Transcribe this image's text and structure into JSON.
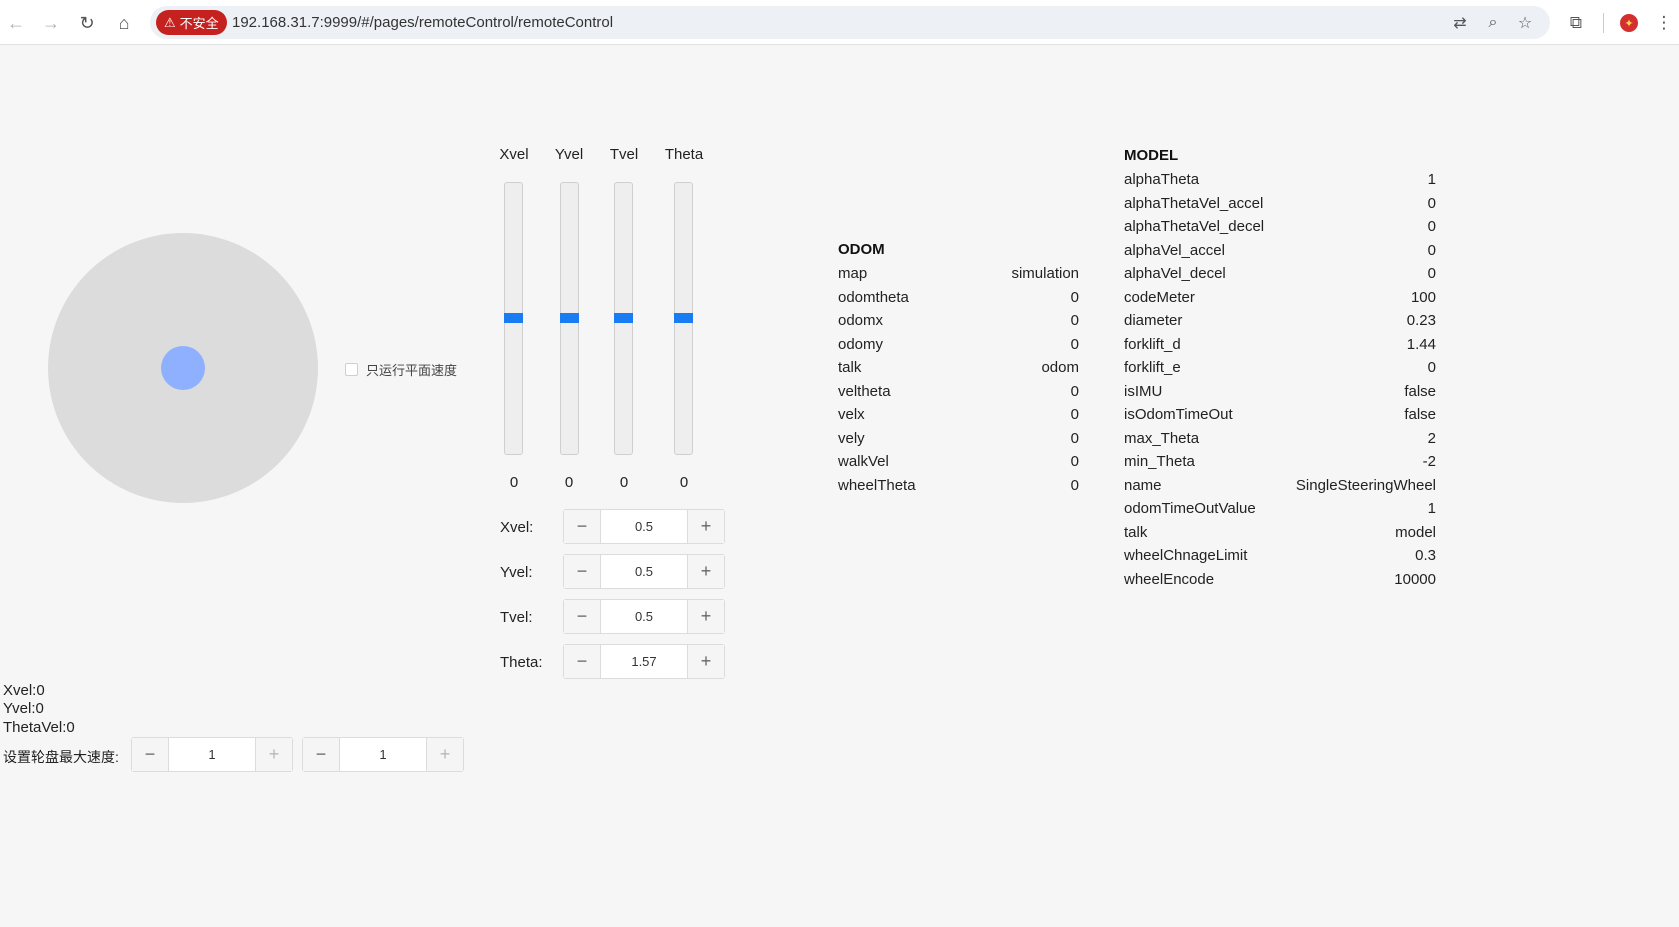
{
  "browser": {
    "url": "192.168.31.7:9999/#/pages/remoteControl/remoteControl",
    "insecure_label": "不安全"
  },
  "joystick": {
    "checkbox_label": "只运行平面速度",
    "checked": false
  },
  "sliders": [
    {
      "label": "Xvel",
      "value": "0"
    },
    {
      "label": "Yvel",
      "value": "0"
    },
    {
      "label": "Tvel",
      "value": "0"
    },
    {
      "label": "Theta",
      "value": "0"
    }
  ],
  "steppers": [
    {
      "label": "Xvel:",
      "value": "0.5"
    },
    {
      "label": "Yvel:",
      "value": "0.5"
    },
    {
      "label": "Tvel:",
      "value": "0.5"
    },
    {
      "label": "Theta:",
      "value": "1.57"
    }
  ],
  "readouts": {
    "xvel": "Xvel:0",
    "yvel": "Yvel:0",
    "thetavel": "ThetaVel:0"
  },
  "max_speed": {
    "label": "设置轮盘最大速度:",
    "value1": "1",
    "value2": "1"
  },
  "odom": {
    "title": "ODOM",
    "rows": [
      {
        "key": "map",
        "value": "simulation"
      },
      {
        "key": "odomtheta",
        "value": "0"
      },
      {
        "key": "odomx",
        "value": "0"
      },
      {
        "key": "odomy",
        "value": "0"
      },
      {
        "key": "talk",
        "value": "odom"
      },
      {
        "key": "veltheta",
        "value": "0"
      },
      {
        "key": "velx",
        "value": "0"
      },
      {
        "key": "vely",
        "value": "0"
      },
      {
        "key": "walkVel",
        "value": "0"
      },
      {
        "key": "wheelTheta",
        "value": "0"
      }
    ]
  },
  "model": {
    "title": "MODEL",
    "rows": [
      {
        "key": "alphaTheta",
        "value": "1"
      },
      {
        "key": "alphaThetaVel_accel",
        "value": "0"
      },
      {
        "key": "alphaThetaVel_decel",
        "value": "0"
      },
      {
        "key": "alphaVel_accel",
        "value": "0"
      },
      {
        "key": "alphaVel_decel",
        "value": "0"
      },
      {
        "key": "codeMeter",
        "value": "100"
      },
      {
        "key": "diameter",
        "value": "0.23"
      },
      {
        "key": "forklift_d",
        "value": "1.44"
      },
      {
        "key": "forklift_e",
        "value": "0"
      },
      {
        "key": "isIMU",
        "value": "false"
      },
      {
        "key": "isOdomTimeOut",
        "value": "false"
      },
      {
        "key": "max_Theta",
        "value": "2"
      },
      {
        "key": "min_Theta",
        "value": "-2"
      },
      {
        "key": "name",
        "value": "SingleSteeringWheel"
      },
      {
        "key": "odomTimeOutValue",
        "value": "1"
      },
      {
        "key": "talk",
        "value": "model"
      },
      {
        "key": "wheelChnageLimit",
        "value": "0.3"
      },
      {
        "key": "wheelEncode",
        "value": "10000"
      }
    ]
  }
}
